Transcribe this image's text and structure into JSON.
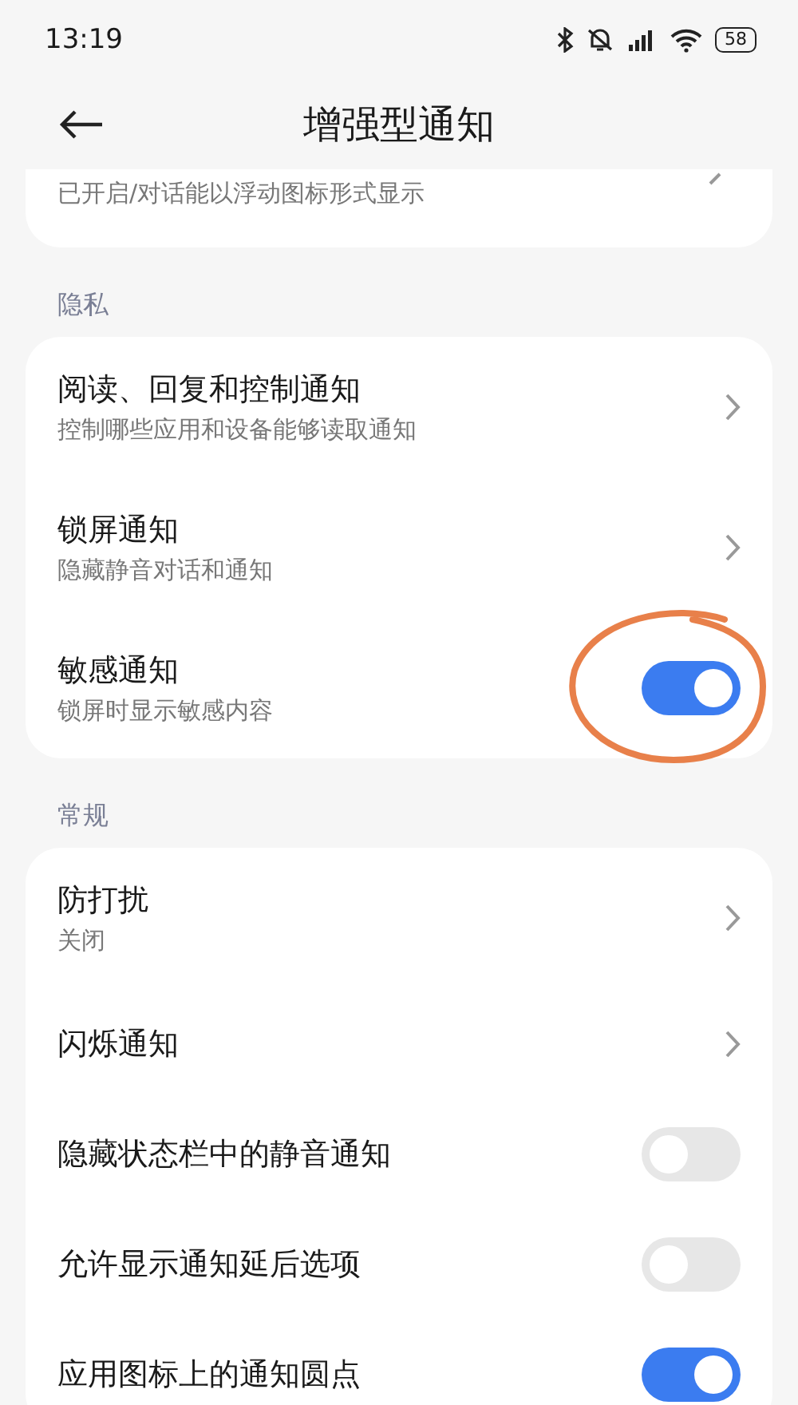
{
  "status_bar": {
    "time": "13:19",
    "battery": "58"
  },
  "header": {
    "title": "增强型通知"
  },
  "top_card": {
    "subtitle": "已开启/对话能以浮动图标形式显示"
  },
  "sections": [
    {
      "heading": "隐私",
      "items": [
        {
          "kind": "link",
          "title": "阅读、回复和控制通知",
          "subtitle": "控制哪些应用和设备能够读取通知"
        },
        {
          "kind": "link",
          "title": "锁屏通知",
          "subtitle": "隐藏静音对话和通知"
        },
        {
          "kind": "toggle",
          "title": "敏感通知",
          "subtitle": "锁屏时显示敏感内容",
          "on": true,
          "circled": true
        }
      ]
    },
    {
      "heading": "常规",
      "items": [
        {
          "kind": "link",
          "title": "防打扰",
          "subtitle": "关闭"
        },
        {
          "kind": "link",
          "title": "闪烁通知"
        },
        {
          "kind": "toggle",
          "title": "隐藏状态栏中的静音通知",
          "on": false
        },
        {
          "kind": "toggle",
          "title": "允许显示通知延后选项",
          "on": false
        },
        {
          "kind": "toggle",
          "title": "应用图标上的通知圆点",
          "on": true
        }
      ]
    }
  ]
}
